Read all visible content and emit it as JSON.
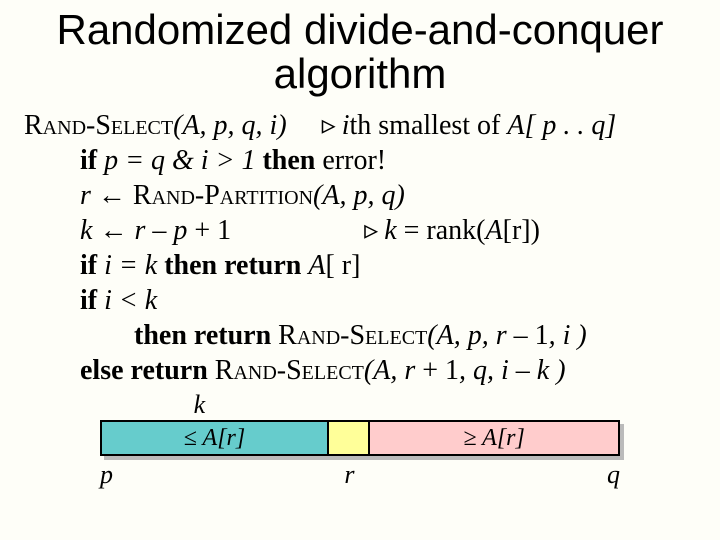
{
  "title_line1": "Randomized divide-and-conquer",
  "title_line2": "algorithm",
  "sig": {
    "fn": "Rand-Select",
    "args_open": "(",
    "a": "A, p, q, i",
    "args_close": ")",
    "comment_i": "i",
    "comment_rest": "th smallest of ",
    "comment_arr": "A",
    "comment_idx": "[ p . . q]"
  },
  "l1": {
    "if": "if",
    "cond": "  p = q  &  i > 1 ",
    "then": "then ",
    "err": "error!"
  },
  "l2": {
    "r": "r ",
    "arrow": "← ",
    "fn": "Rand-Partition",
    "args": "(A, p, q)"
  },
  "l3": {
    "k": "k ",
    "arrow": "← ",
    "expr": "r – p ",
    "plus": "+ 1",
    "comment_k": "k ",
    "comment_eq": "= rank(",
    "comment_arr": "A",
    "comment_idx": "[r])"
  },
  "l4": {
    "if": "if",
    "cond": "  i = k ",
    "then": " then return ",
    "arr": "A",
    "idx": "[ r]"
  },
  "l5": {
    "if": "if",
    "cond": "  i < k"
  },
  "l6": {
    "then": "then return ",
    "fn": "Rand-Select",
    "args": "(A, p, r – ",
    "one": "1",
    "rest": ", i )"
  },
  "l7": {
    "else": "else return ",
    "fn": "Rand-Select",
    "args": "(A, r ",
    "plus": "+ 1",
    "rest": ", q, i – k )"
  },
  "diagram": {
    "k": "k",
    "left": "≤ A[r]",
    "right": "≥ A[r]",
    "p": "p",
    "r": "r",
    "q": "q"
  }
}
